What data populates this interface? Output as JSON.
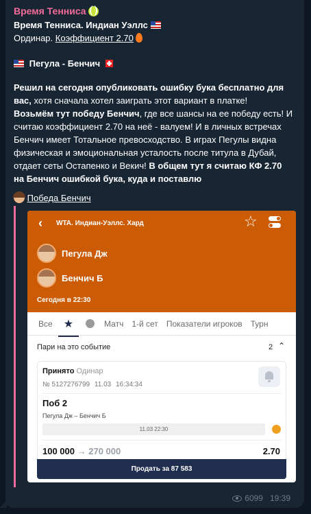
{
  "message": {
    "channel_name": "Время Тенниса",
    "title": "Время Тенниса. Индиан Уэллс",
    "bet_type_prefix": "Ординар.",
    "coef_link": "Коэффициент 2.70",
    "match_line": "Пегула - Бенчич",
    "p1_bold": "Решил на сегодня опубликовать ошибку бука бесплатно для вас,",
    "p1_rest": " хотя сначала хотел заиграть этот вариант в платке!",
    "p2_bold": "Возьмём тут победу Бенчич",
    "p2_rest": ", где все шансы на ее победу есть! И считаю коэффициент 2.70 на неё - валуем! И в личных встречах Бенчич имеет Тотальное превосходство. В играх Пегулы видна физическая и эмоциональная усталость после титула в Дубай, отдает сеты Остапенко и Векич! ",
    "p2_bold2": "В общем тут я считаю КФ 2.70 на Бенчич ошибкой бука, куда и поставлю",
    "pick_link": "Победа Бенчич",
    "views": "6099",
    "time": "19:39"
  },
  "screenshot": {
    "tournament": "WTA. Индиан-Уэллс. Хард",
    "player1": "Пегула Дж",
    "player2": "Бенчич Б",
    "start_time": "Сегодня в 22:30",
    "tabs": [
      "Все",
      "Матч",
      "1-й сет",
      "Показатели игроков",
      "Турн"
    ],
    "section_title": "Пари на это событие",
    "section_count": "2",
    "bet": {
      "status": "Принято",
      "type": "Одинар",
      "number": "№ 5127276799",
      "date": "11.03",
      "time": "16:34:34",
      "pick": "Поб 2",
      "match": "Пегула Дж – Бенчич Б",
      "event_date": "11.03 22:30",
      "stake": "100 000",
      "payout": "270 000",
      "coef": "2.70"
    },
    "sell_button": "Продать за 87 583"
  },
  "colors": {
    "accent_pink": "#f46a9b",
    "header_orange": "#cb5b05",
    "sell_navy": "#1f2d4f",
    "chat_bg": "#0e1621",
    "bubble_bg": "#182533"
  }
}
